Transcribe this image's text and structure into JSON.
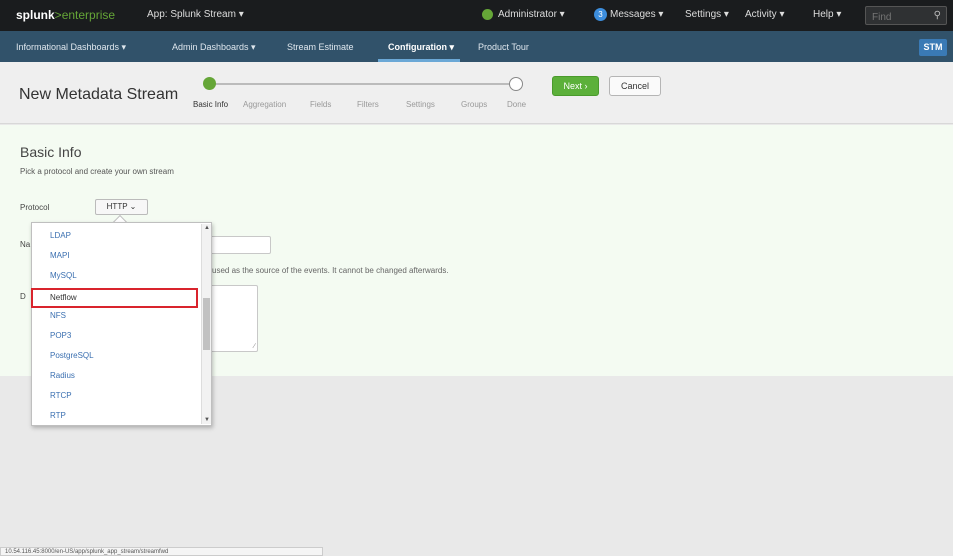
{
  "topbar": {
    "logo_part1": "splunk",
    "logo_part2": ">",
    "logo_part3": "enterprise",
    "app_label": "App: Splunk Stream ▾",
    "administrator": "Administrator ▾",
    "messages": "Messages ▾",
    "messages_count": "3",
    "settings": "Settings ▾",
    "activity": "Activity ▾",
    "help": "Help ▾",
    "find_placeholder": "Find"
  },
  "nav": {
    "items": [
      "Informational Dashboards ▾",
      "Admin Dashboards ▾",
      "Stream Estimate",
      "Configuration ▾",
      "Product Tour"
    ],
    "badge": "STM"
  },
  "header": {
    "title": "New Metadata Stream",
    "steps": [
      "Basic Info",
      "Aggregation",
      "Fields",
      "Filters",
      "Settings",
      "Groups",
      "Done"
    ],
    "next_label": "Next ›",
    "cancel_label": "Cancel"
  },
  "form": {
    "section_title": "Basic Info",
    "section_sub": "Pick a protocol and create your own stream",
    "protocol_label": "Protocol",
    "protocol_value": "HTTP ⌄",
    "name_label": "Na",
    "help_text": "used as the source of the events. It cannot be changed afterwards.",
    "description_label": "D"
  },
  "dropdown": {
    "items": [
      "LDAP",
      "MAPI",
      "MySQL",
      "Netflow",
      "NFS",
      "POP3",
      "PostgreSQL",
      "Radius",
      "RTCP",
      "RTP"
    ],
    "selected": "Netflow"
  },
  "statusbar": {
    "url": "10.54.116.45:8000/en-US/app/splunk_app_stream/streamfwd"
  },
  "colors": {
    "topbar_bg": "#1a1c1e",
    "nav_bg": "#31526a",
    "accent_green": "#65a637",
    "highlight_red": "#d9242d"
  }
}
